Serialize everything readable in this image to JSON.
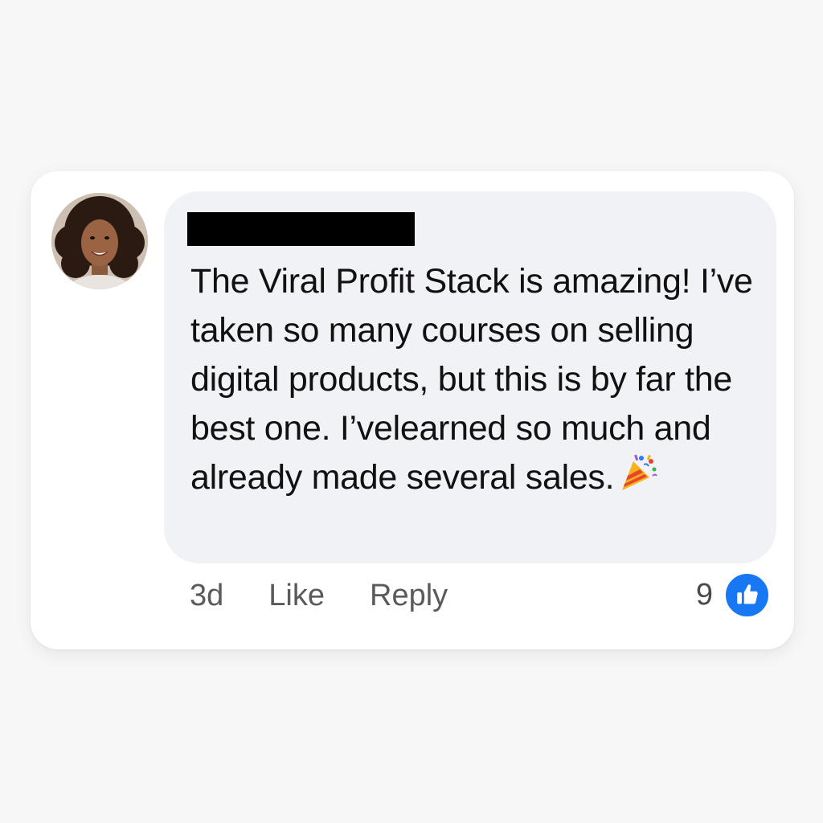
{
  "comment": {
    "author_name": "",
    "text": "The Viral Profit Stack is amazing! I’ve taken so many courses on selling digital products, but this is by far the best one. I’velearned so much and already made several sales.",
    "emoji": "party-popper-icon"
  },
  "actions": {
    "time": "3d",
    "like_label": "Like",
    "reply_label": "Reply"
  },
  "reactions": {
    "count": "9",
    "type": "like-thumb-icon",
    "badge_color": "#1877f2"
  }
}
